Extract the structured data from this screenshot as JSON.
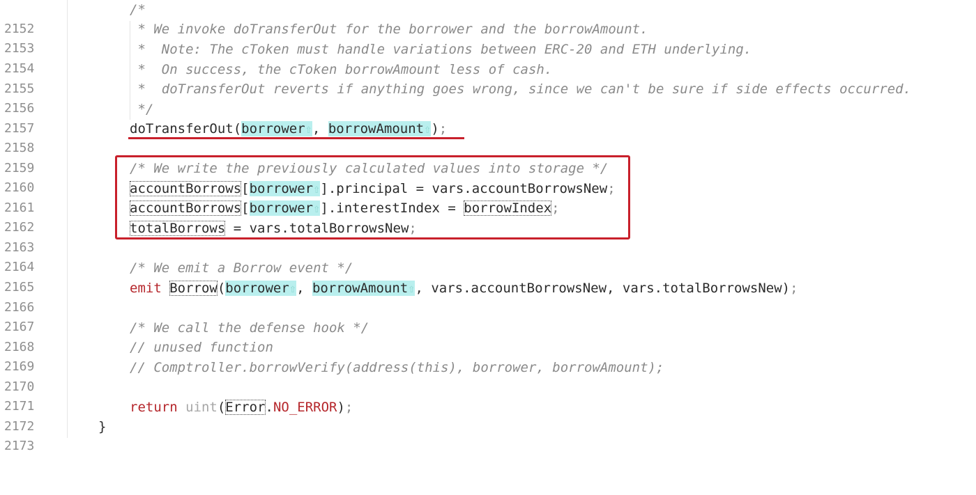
{
  "editor": {
    "colors": {
      "highlight": "#b9efee",
      "annotation_red": "#c8202b",
      "comment": "#8a8a8a",
      "keyword": "#b5262b"
    },
    "lines": [
      {
        "num": "2152",
        "text": "/*"
      },
      {
        "num": "2153",
        "text": " * We invoke doTransferOut for the borrower and the borrowAmount."
      },
      {
        "num": "2154",
        "text": " *  Note: The cToken must handle variations between ERC-20 and ETH underlying."
      },
      {
        "num": "2155",
        "text": " *  On success, the cToken borrowAmount less of cash."
      },
      {
        "num": "2156",
        "text": " *  doTransferOut reverts if anything goes wrong, since we can't be sure if side effects occurred."
      },
      {
        "num": "2157",
        "text": " */"
      },
      {
        "num": "2158",
        "t1": "doTransferOut(",
        "a1": "borrower",
        "t2": ", ",
        "a2": "borrowAmount",
        "t3": ")",
        "t4": ";"
      },
      {
        "num": "2159"
      },
      {
        "num": "2160",
        "text": "/* We write the previously calculated values into storage */"
      },
      {
        "num": "2161",
        "t1": "accountBorrows",
        "t2": "[",
        "a1": "borrower",
        "t3": "].principal = vars.accountBorrowsNew",
        "t4": ";"
      },
      {
        "num": "2162",
        "t1": "accountBorrows",
        "t2": "[",
        "a1": "borrower",
        "t3": "].interestIndex = ",
        "t5": "borrowIndex",
        "t4": ";"
      },
      {
        "num": "2163",
        "t1": "totalBorrows",
        "t3": " = vars.totalBorrowsNew",
        "t4": ";"
      },
      {
        "num": "2164"
      },
      {
        "num": "2165",
        "text": "/* We emit a Borrow event */"
      },
      {
        "num": "2166",
        "kw": "emit ",
        "t1": "Borrow",
        "t2": "(",
        "a1": "borrower",
        "t3": ", ",
        "a2": "borrowAmount",
        "t5": ", vars.accountBorrowsNew, vars.totalBorrowsNew)",
        "t4": ";"
      },
      {
        "num": "2167"
      },
      {
        "num": "2168",
        "text": "/* We call the defense hook */"
      },
      {
        "num": "2169",
        "text": "// unused function"
      },
      {
        "num": "2170",
        "text": "// Comptroller.borrowVerify(address(this), borrower, borrowAmount);"
      },
      {
        "num": "2171"
      },
      {
        "num": "2172",
        "kw": "return ",
        "type": "uint",
        "t2": "(",
        "t1": "Error",
        "t3": ".",
        "const": "NO_ERROR",
        "t5": ")",
        "t4": ";"
      },
      {
        "num": "2173",
        "text": "}"
      }
    ],
    "arrow_glyph": "⇧"
  }
}
